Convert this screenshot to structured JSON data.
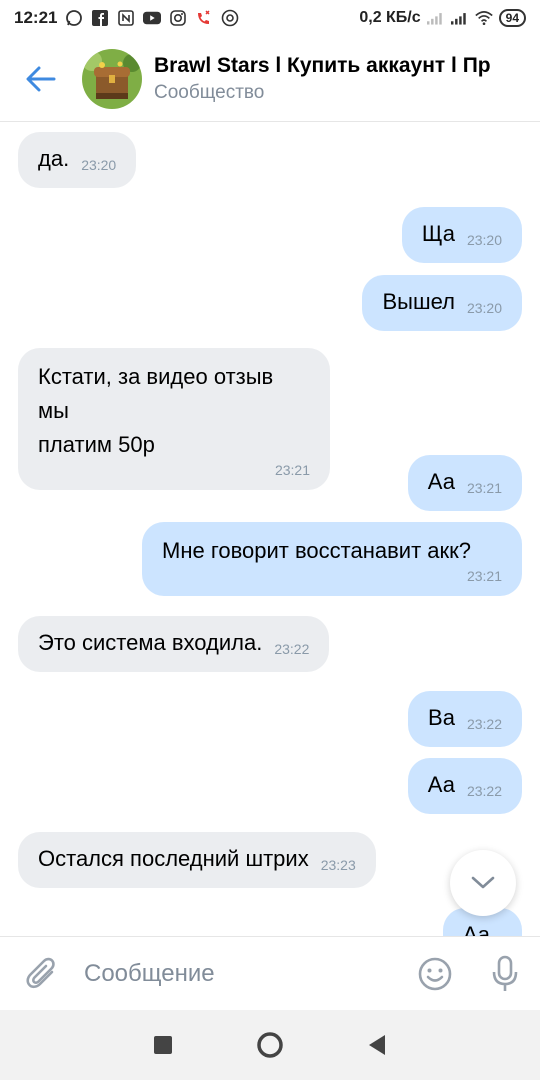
{
  "statusbar": {
    "time": "12:21",
    "network_speed": "0,2 КБ/с",
    "battery": "94",
    "icons": [
      "whatsapp-icon",
      "facebook-icon",
      "nfc-icon",
      "youtube-icon",
      "instagram-icon",
      "missed-call-icon",
      "at-sign-icon",
      "signal-icon",
      "wifi-icon",
      "battery-icon"
    ]
  },
  "header": {
    "title": "Brawl Stars l Купить аккаунт l Пр",
    "subtitle": "Сообщество"
  },
  "messages": [
    {
      "dir": "in",
      "text": "да.",
      "time": "23:20"
    },
    {
      "dir": "out",
      "text": "Ща",
      "time": "23:20"
    },
    {
      "dir": "out",
      "text": "Вышел",
      "time": "23:20"
    },
    {
      "dir": "in",
      "text_lines": [
        "Кстати, за видео отзыв мы",
        "платим 50р"
      ],
      "time": "23:21"
    },
    {
      "dir": "out",
      "text": "Аа",
      "time": "23:21"
    },
    {
      "dir": "out",
      "text": "Мне говорит восстанавит акк?",
      "time": "23:21"
    },
    {
      "dir": "in",
      "text": "Это система входила.",
      "time": "23:22"
    },
    {
      "dir": "out",
      "text": "Ва",
      "time": "23:22"
    },
    {
      "dir": "out",
      "text": "Аа",
      "time": "23:22"
    },
    {
      "dir": "in",
      "text": "Остался последний штрих",
      "time": "23:23"
    },
    {
      "dir": "out",
      "text": "Аа",
      "time": ""
    }
  ],
  "composer": {
    "placeholder": "Сообщение"
  },
  "colors": {
    "accent": "#3f8ae0",
    "incoming_bubble": "#ebedf0",
    "outgoing_bubble": "#cce4ff",
    "secondary_text": "#818c99"
  }
}
